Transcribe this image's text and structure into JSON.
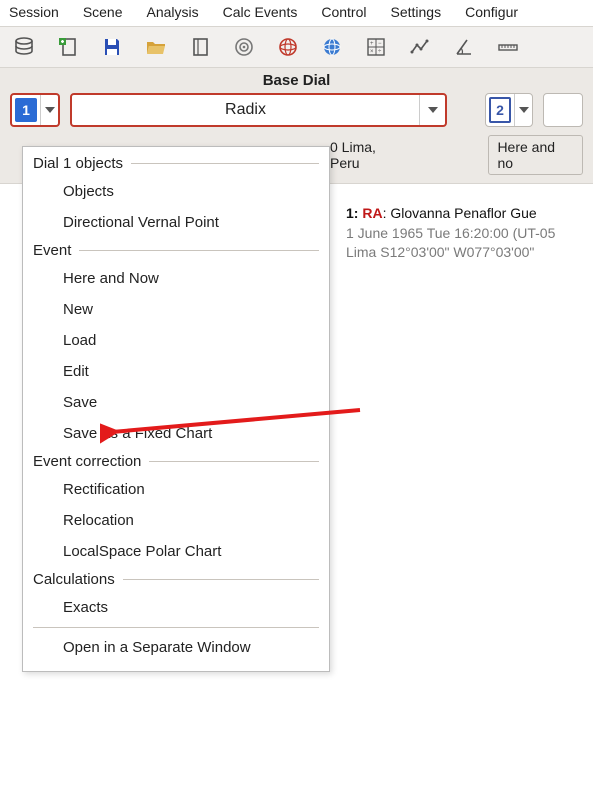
{
  "menubar": {
    "items": [
      "Session",
      "Scene",
      "Analysis",
      "Calc Events",
      "Control",
      "Settings",
      "Configur"
    ]
  },
  "toolbar": {
    "icons": [
      "database-icon",
      "new-doc-icon",
      "save-icon",
      "folder-open-icon",
      "notebook-icon",
      "target-circle-icon",
      "globe-red-icon",
      "globe-blue-icon",
      "calculator-icon",
      "line-chart-icon",
      "angle-icon",
      "ruler-icon"
    ]
  },
  "dial": {
    "title": "Base Dial",
    "num1": "1",
    "select1": "Radix",
    "num2": "2",
    "location_fragment": "0 Lima, Peru",
    "here_and_now": "Here and no"
  },
  "info": {
    "idx": "1:",
    "ra": "RA",
    "name": ": Glovanna Penaflor Gue",
    "line2": "1 June 1965 Tue 16:20:00 (UT-05",
    "line3": "Lima S12°03'00\" W077°03'00\""
  },
  "context_menu": {
    "sections": [
      {
        "header": "Dial 1 objects",
        "items": [
          "Objects",
          "Directional Vernal Point"
        ]
      },
      {
        "header": "Event",
        "items": [
          "Here and Now",
          "New",
          "Load",
          "Edit",
          "Save",
          "Save As a Fixed Chart"
        ]
      },
      {
        "header": "Event correction",
        "items": [
          "Rectification",
          "Relocation",
          "LocalSpace Polar Chart"
        ]
      },
      {
        "header": "Calculations",
        "items": [
          "Exacts"
        ]
      }
    ],
    "final_item": "Open in a Separate Window"
  },
  "colors": {
    "accent_red": "#c03a2b",
    "arrow_red": "#e31b1b"
  }
}
